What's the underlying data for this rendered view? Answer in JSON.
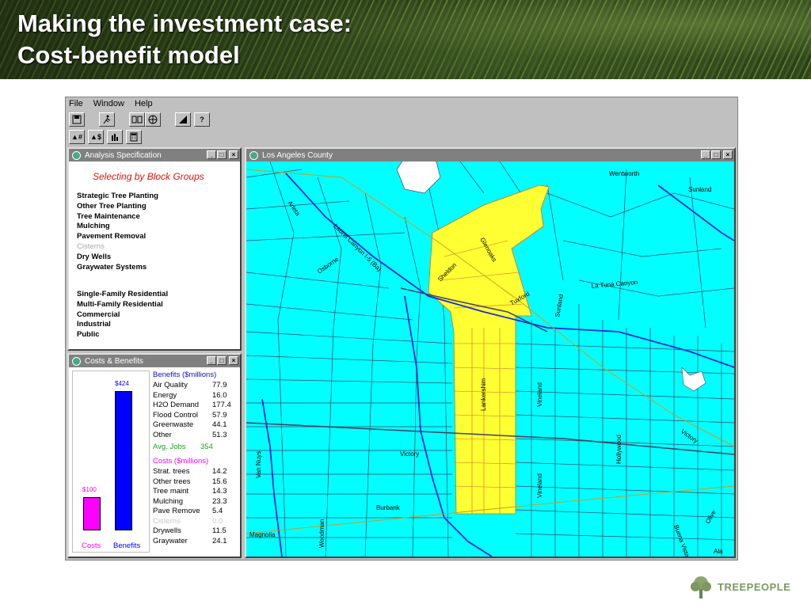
{
  "slide": {
    "title_line1": "Making the investment case:",
    "title_line2": "Cost-benefit model",
    "logo_text": "TREEPEOPLE"
  },
  "menu": [
    "File",
    "Window",
    "Help"
  ],
  "toolbar_icons": [
    "save-icon",
    "run-icon",
    "compare-icon",
    "globe-icon",
    "chart-icon",
    "help-icon",
    "tree-number-icon",
    "tree-dollar-icon",
    "bar-chart-icon",
    "calculator-icon"
  ],
  "toolbar_labels": {
    "help": "?",
    "tree_num": "▲#",
    "tree_dollar": "▲$"
  },
  "analysis": {
    "title": "Analysis Specification",
    "heading": "Selecting by Block Groups",
    "strategies": [
      {
        "label": "Strategic Tree Planting",
        "enabled": true
      },
      {
        "label": "Other Tree Planting",
        "enabled": true
      },
      {
        "label": "Tree Maintenance",
        "enabled": true
      },
      {
        "label": "Mulching",
        "enabled": true
      },
      {
        "label": "Pavement Removal",
        "enabled": true
      },
      {
        "label": "Cisterns",
        "enabled": false
      },
      {
        "label": "Dry Wells",
        "enabled": true
      },
      {
        "label": "Graywater Systems",
        "enabled": true
      }
    ],
    "landuses": [
      "Single-Family Residential",
      "Multi-Family Residential",
      "Commercial",
      "Industrial",
      "Public"
    ]
  },
  "costs_benefits": {
    "title": "Costs & Benefits",
    "cost_total_label": "$100",
    "benefit_total_label": "$424",
    "cost_total": 100,
    "benefit_total": 424,
    "cost_bar_label": "Costs",
    "benefit_bar_label": "Benefits",
    "benefits_header": "Benefits  ($millions)",
    "benefits": [
      {
        "name": "Air Quality",
        "value": "77.9"
      },
      {
        "name": "Energy",
        "value": "16.0"
      },
      {
        "name": "H2O Demand",
        "value": "177.4"
      },
      {
        "name": "Flood Control",
        "value": "57.9"
      },
      {
        "name": "Greenwaste",
        "value": "44.1"
      },
      {
        "name": "Other",
        "value": "51.3"
      }
    ],
    "jobs_label": "Avg. Jobs",
    "jobs_value": "354",
    "costs_header": "Costs  ($millions)",
    "costs": [
      {
        "name": "Strat. trees",
        "value": "14.2",
        "enabled": true
      },
      {
        "name": "Other trees",
        "value": "15.6",
        "enabled": true
      },
      {
        "name": "Tree maint",
        "value": "14.3",
        "enabled": true
      },
      {
        "name": "Mulching",
        "value": "23.3",
        "enabled": true
      },
      {
        "name": "Pave Remove",
        "value": "5.4",
        "enabled": true
      },
      {
        "name": "Cisterns",
        "value": "0.0",
        "enabled": false
      },
      {
        "name": "Drywells",
        "value": "11.5",
        "enabled": true
      },
      {
        "name": "Graywater",
        "value": "24.1",
        "enabled": true
      }
    ]
  },
  "map": {
    "title": "Los Angeles County",
    "water_color": "#00ffff",
    "selected_color": "#ffff33",
    "street_labels": [
      "Arleta",
      "Laurel Canyon I-5 (Ba)",
      "Osborne",
      "Glenoaks",
      "Sheldon",
      "Tuxford",
      "La Tuna Canyon",
      "Sunland",
      "Wentworth",
      "Sunland",
      "Lankershim",
      "Vineland",
      "Vineland",
      "Hollywood",
      "Victory",
      "Victory",
      "Burbank",
      "Magnolia",
      "Woodman",
      "Van Nuys",
      "Buena Vista",
      "Olive",
      "Ala"
    ]
  },
  "colors": {
    "cost_bar": "#ff00ff",
    "benefit_bar": "#0000ff",
    "jobs": "#20a020",
    "costs_header": "#ff00ff",
    "benefits_header": "#1010c0",
    "spec_heading": "#e0140a"
  }
}
